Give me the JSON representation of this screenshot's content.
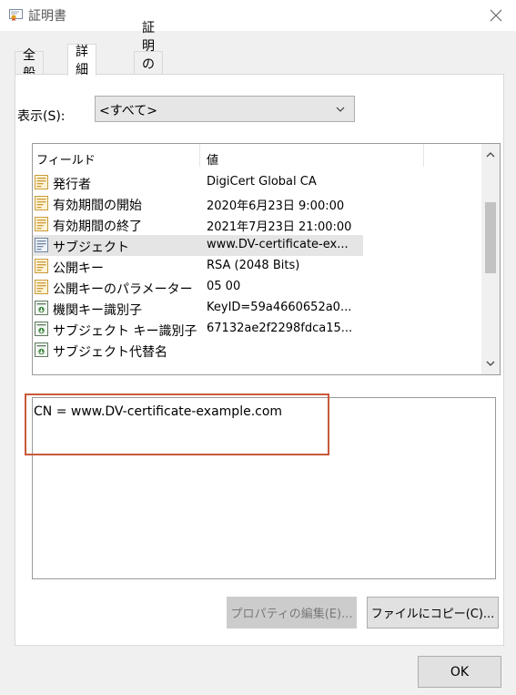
{
  "window": {
    "title": "証明書"
  },
  "tabs": [
    {
      "label": "全般"
    },
    {
      "label": "詳細"
    },
    {
      "label": "証明のパス"
    }
  ],
  "show": {
    "label": "表示(S):",
    "selected": "<すべて>"
  },
  "list": {
    "headers": {
      "field": "フィールド",
      "value": "値"
    },
    "rows": [
      {
        "field": "発行者",
        "value": "DigiCert Global CA",
        "icon": "certificate-field-icon"
      },
      {
        "field": "有効期間の開始",
        "value": "2020年6月23日 9:00:00",
        "icon": "certificate-field-icon"
      },
      {
        "field": "有効期間の終了",
        "value": "2021年7月23日 21:00:00",
        "icon": "certificate-field-icon"
      },
      {
        "field": "サブジェクト",
        "value": "www.DV-certificate-ex...",
        "icon": "certificate-field-icon"
      },
      {
        "field": "公開キー",
        "value": "RSA (2048 Bits)",
        "icon": "certificate-field-icon"
      },
      {
        "field": "公開キーのパラメーター",
        "value": "05 00",
        "icon": "certificate-field-icon"
      },
      {
        "field": "機関キー識別子",
        "value": "KeyID=59a4660652a0...",
        "icon": "extension-icon"
      },
      {
        "field": "サブジェクト キー識別子",
        "value": "67132ae2f2298fdca15...",
        "icon": "extension-icon"
      },
      {
        "field": "サブジェクト代替名",
        "value": "",
        "icon": "extension-icon"
      }
    ]
  },
  "detail": {
    "text": "CN = www.DV-certificate-example.com"
  },
  "buttons": {
    "edit_properties": "プロパティの編集(E)...",
    "copy_to_file": "ファイルにコピー(C)...",
    "ok": "OK"
  },
  "colors": {
    "highlight": "#c9593b"
  }
}
